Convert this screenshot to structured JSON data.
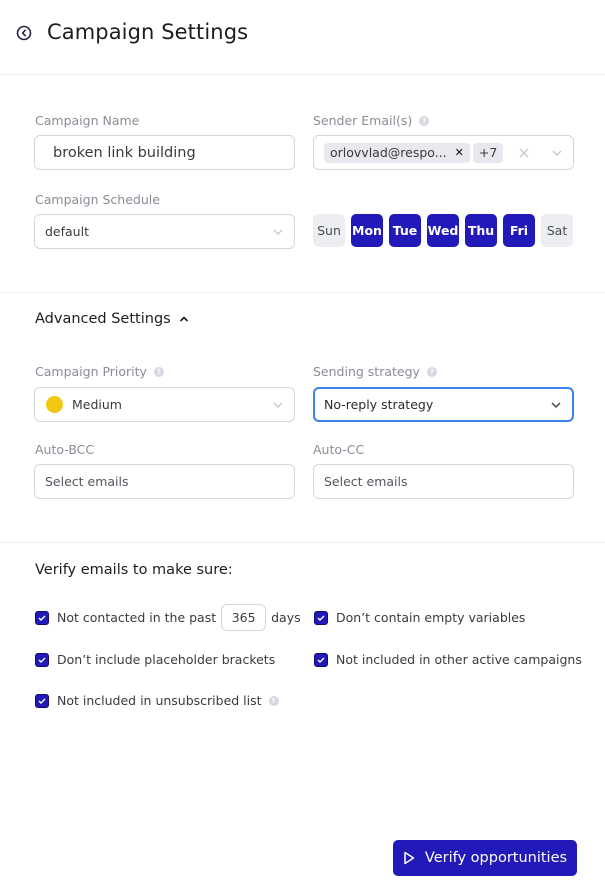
{
  "header": {
    "title": "Campaign Settings",
    "back_icon": "circle-chevron-left-icon"
  },
  "general": {
    "campaign_name_label": "Campaign Name",
    "campaign_name_value": "broken link building",
    "sender_emails_label": "Sender Email(s)",
    "sender_email_tag": "orlovvlad@respo...",
    "sender_email_more": "+7",
    "campaign_schedule_label": "Campaign Schedule",
    "campaign_schedule_value": "default",
    "days": [
      {
        "label": "Sun",
        "selected": false
      },
      {
        "label": "Mon",
        "selected": true
      },
      {
        "label": "Tue",
        "selected": true
      },
      {
        "label": "Wed",
        "selected": true
      },
      {
        "label": "Thu",
        "selected": true
      },
      {
        "label": "Fri",
        "selected": true
      },
      {
        "label": "Sat",
        "selected": false
      }
    ]
  },
  "advanced": {
    "title": "Advanced Settings",
    "expanded": true,
    "priority_label": "Campaign Priority",
    "priority_value": "Medium",
    "priority_color": "#f0c814",
    "strategy_label": "Sending strategy",
    "strategy_value": "No-reply strategy",
    "auto_bcc_label": "Auto-BCC",
    "auto_bcc_placeholder": "Select emails",
    "auto_cc_label": "Auto-CC",
    "auto_cc_placeholder": "Select emails"
  },
  "verify": {
    "title": "Verify emails to make sure:",
    "not_contacted_prefix": "Not contacted in the past",
    "not_contacted_days": "365",
    "not_contacted_suffix": "days",
    "items": [
      {
        "label": "Don’t contain empty variables",
        "checked": true
      },
      {
        "label": "Don’t include placeholder brackets",
        "checked": true
      },
      {
        "label": "Not included in other active campaigns",
        "checked": true
      },
      {
        "label": "Not included in unsubscribed list",
        "checked": true
      }
    ],
    "button_label": "Verify opportunities"
  },
  "colors": {
    "accent": "#2119b8",
    "focus": "#3b82e6"
  }
}
